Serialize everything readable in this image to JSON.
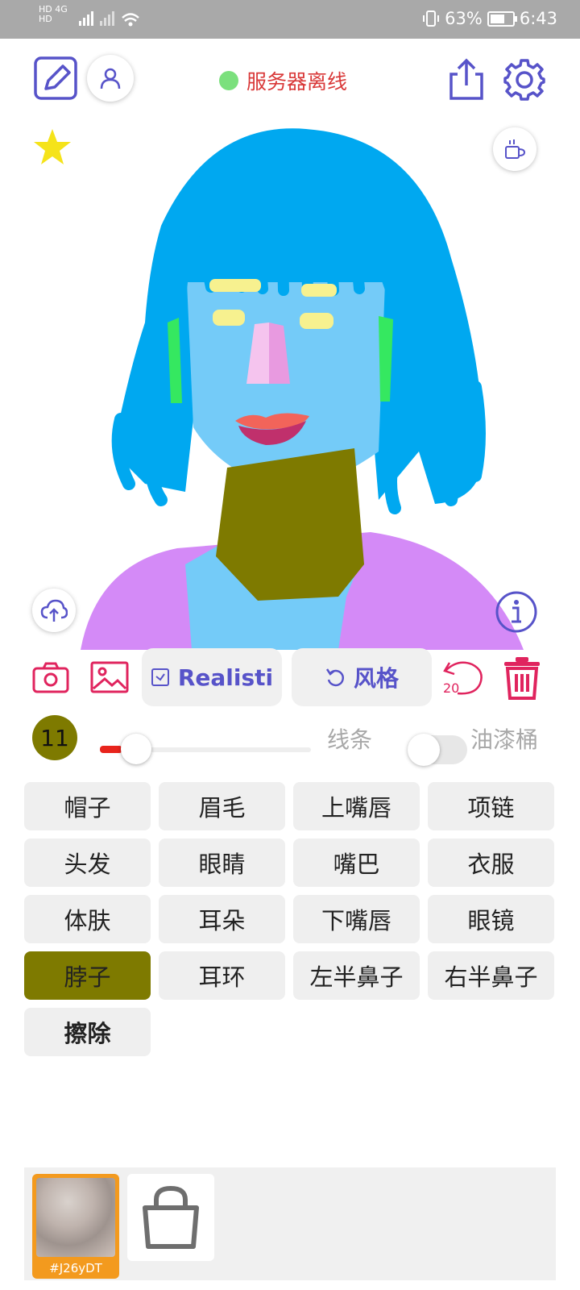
{
  "status_bar": {
    "net_top": "HD 4G",
    "net_bottom": "HD",
    "battery": "63%",
    "time": "6:43"
  },
  "header": {
    "server_status": "服务器离线",
    "server_dot_color": "#7be07d"
  },
  "toolbar": {
    "style_model": "Realisti",
    "style_button": "风格",
    "undo_count": "20"
  },
  "brush": {
    "size": "11",
    "size_fraction": 0.05,
    "line_label": "线条",
    "bucket_label": "油漆桶",
    "bucket_on": false
  },
  "parts": [
    {
      "label": "帽子"
    },
    {
      "label": "眉毛"
    },
    {
      "label": "上嘴唇"
    },
    {
      "label": "项链"
    },
    {
      "label": "头发"
    },
    {
      "label": "眼睛"
    },
    {
      "label": "嘴巴"
    },
    {
      "label": "衣服"
    },
    {
      "label": "体肤"
    },
    {
      "label": "耳朵"
    },
    {
      "label": "下嘴唇"
    },
    {
      "label": "眼镜"
    },
    {
      "label": "脖子",
      "active": true
    },
    {
      "label": "耳环"
    },
    {
      "label": "左半鼻子"
    },
    {
      "label": "右半鼻子"
    },
    {
      "label": "擦除",
      "bold": true
    }
  ],
  "gallery": {
    "items": [
      {
        "label": "#J26yDT"
      }
    ]
  },
  "colors": {
    "accent": "#5753c9",
    "danger": "#e0245e",
    "neck": "#7e7a00",
    "hair": "#00a8f0",
    "skin": "#74cbf8",
    "clothes": "#d48af7"
  }
}
